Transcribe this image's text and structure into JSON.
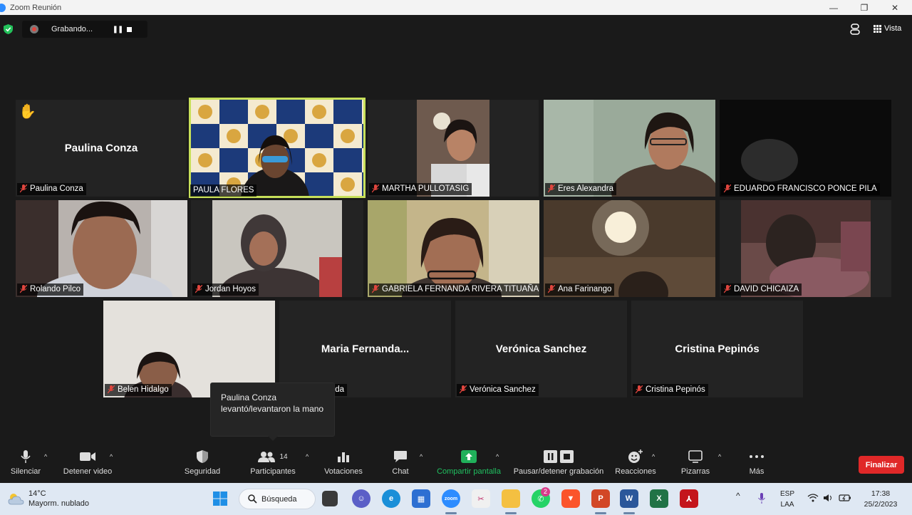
{
  "window": {
    "title": "Zoom Reunión",
    "minimize": "—",
    "restore": "❐",
    "close": "✕"
  },
  "recording": {
    "status": "Grabando...",
    "pause": "❚❚"
  },
  "view": {
    "label": "Vista"
  },
  "tiles": [
    {
      "name": "Paulina Conza",
      "center": "Paulina Conza",
      "hand": "✋"
    },
    {
      "name": "PAULA FLORES"
    },
    {
      "name": "MARTHA PULLOTASIG"
    },
    {
      "name": "Eres  Alexandra"
    },
    {
      "name": "EDUARDO FRANCISCO PONCE PILA"
    },
    {
      "name": "Rolando Pilco"
    },
    {
      "name": "Jordan Hoyos"
    },
    {
      "name": "GABRIELA FERNANDA RIVERA TITUAÑA"
    },
    {
      "name": "Ana Farinango"
    },
    {
      "name": "DAVID CHICAIZA"
    },
    {
      "name": "Belen Hidalgo"
    },
    {
      "name": "Maria Fernanda Pianda",
      "tag": "nanda Pianda",
      "center": "Maria  Fernanda..."
    },
    {
      "name": "Verónica Sanchez",
      "center": "Verónica Sanchez"
    },
    {
      "name": "Cristina Pepinós",
      "center": "Cristina Pepinós"
    }
  ],
  "tooltip": {
    "text": "Paulina Conza levantó/levantaron la mano"
  },
  "toolbar": {
    "mute": "Silenciar",
    "video": "Detener video",
    "security": "Seguridad",
    "participants": "Participantes",
    "participants_count": "14",
    "polls": "Votaciones",
    "chat": "Chat",
    "share": "Compartir pantalla",
    "record": "Pausar/detener grabación",
    "reactions": "Reacciones",
    "whiteboards": "Pizarras",
    "more": "Más",
    "end": "Finalizar",
    "caret": "^"
  },
  "taskbar": {
    "weather_temp": "14°C",
    "weather_desc": "Mayorm. nublado",
    "search": "Búsqueda",
    "lang1": "ESP",
    "lang2": "LAA",
    "time": "17:38",
    "date": "25/2/2023",
    "badge": "2",
    "tray_caret": "^"
  },
  "colors": {
    "accent": "#2d8cff",
    "share": "#20b05a",
    "end": "#e02828",
    "active_speaker": "#c8e05a"
  }
}
